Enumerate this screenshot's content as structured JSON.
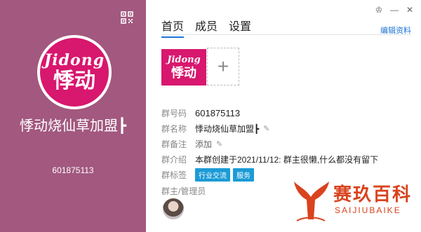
{
  "profile": {
    "avatar_logo_latin": "Jidong",
    "avatar_logo_cn": "悸动",
    "group_name": "悸动烧仙草加盟┣",
    "group_number": "601875113"
  },
  "tabs": [
    {
      "label": "首页",
      "active": true
    },
    {
      "label": "成员",
      "active": false
    },
    {
      "label": "设置",
      "active": false
    }
  ],
  "window_controls": {
    "skin": "♔",
    "minimize": "—",
    "close": "✕"
  },
  "edit_label": "编辑资料",
  "photo": {
    "logo_latin": "Jidong",
    "logo_cn": "悸动",
    "add_symbol": "+"
  },
  "info": {
    "number_label": "群号码",
    "number_value": "601875113",
    "name_label": "群名称",
    "name_value": "悸动烧仙草加盟┣",
    "remark_label": "群备注",
    "remark_value": "添加",
    "intro_label": "群介绍",
    "intro_value": "本群创建于2021/11/12:  群主很懒,什么都没有留下",
    "tags_label": "群标签",
    "tags": [
      "行业交流",
      "服务"
    ]
  },
  "admins_label": "群主/管理员",
  "watermark": {
    "main": "赛玖百科",
    "sub": "SAIJIUBAIKE"
  },
  "colors": {
    "left_bg": "#a2587f",
    "logo_pink": "#d8176e",
    "accent": "#1e74d8",
    "tag_bg": "#1c9bd6",
    "watermark": "#d9431e"
  }
}
